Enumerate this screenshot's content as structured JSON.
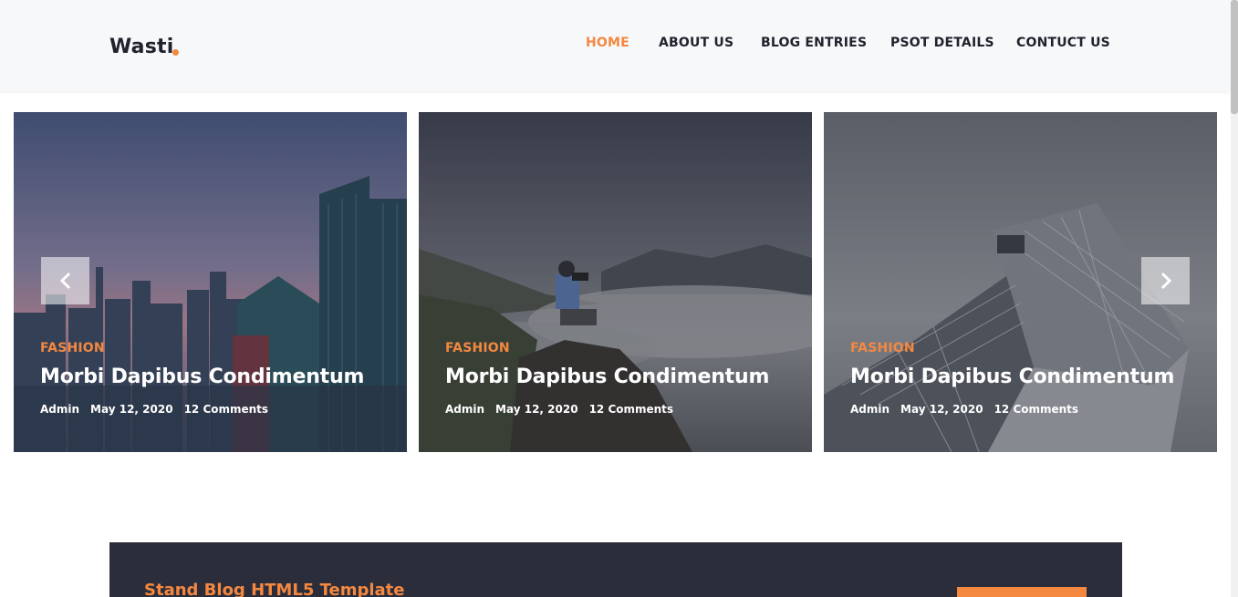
{
  "site": {
    "logo": "Wasti",
    "accent_color": "#f48840",
    "text_color": "#20232e"
  },
  "nav": {
    "items": [
      {
        "label": "HOME",
        "active": true
      },
      {
        "label": "ABOUT US",
        "active": false
      },
      {
        "label": "BLOG ENTRIES",
        "active": false
      },
      {
        "label": "PSOT DETAILS",
        "active": false
      },
      {
        "label": "CONTUCT US",
        "active": false
      }
    ]
  },
  "slider": {
    "prev_icon": "chevron-left-icon",
    "next_icon": "chevron-right-icon",
    "cards": [
      {
        "category": "FASHION",
        "title": "Morbi Dapibus Condimentum",
        "author": "Admin",
        "date": "May 12, 2020",
        "comments": "12 Comments",
        "image": "city-skyline-photo"
      },
      {
        "category": "FASHION",
        "title": "Morbi Dapibus Condimentum",
        "author": "Admin",
        "date": "May 12, 2020",
        "comments": "12 Comments",
        "image": "photographer-mountains-photo"
      },
      {
        "category": "FASHION",
        "title": "Morbi Dapibus Condimentum",
        "author": "Admin",
        "date": "May 12, 2020",
        "comments": "12 Comments",
        "image": "glass-building-photo"
      }
    ]
  },
  "cta": {
    "title": "Stand Blog HTML5 Template"
  }
}
